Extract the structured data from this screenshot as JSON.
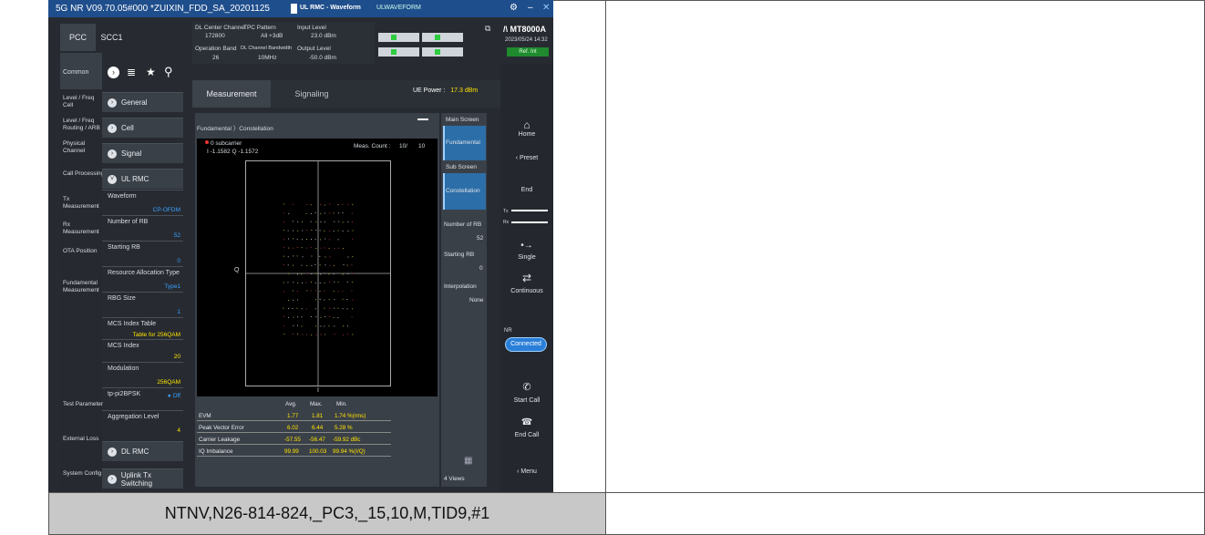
{
  "window": {
    "title": "5G NR V09.70.05#000  *ZUIXIN_FDD_SA_20201125",
    "center_title": "UL RMC - Waveform",
    "center_sub": "ULWAVEFORM"
  },
  "caption": "NTNV,N26-814-824,_PC3,_15,10,M,TID9,#1",
  "carrier_tabs": [
    "PCC",
    "SCC1"
  ],
  "info": {
    "dl_center_channel_label": "DL Center Channel",
    "dl_center_channel_value": "172800",
    "tpc_label": "TPC Pattern",
    "tpc_value": "All +3dB",
    "input_level_label": "Input Level",
    "input_level_value": "23.0 dBm",
    "op_band_label": "Operation Band",
    "op_band_value": "26",
    "dl_bw_label": "DL Channel Bandwidth",
    "dl_bw_value": "10MHz",
    "output_level_label": "Output Level",
    "output_level_value": "-50.0 dBm"
  },
  "brand": {
    "name": "MT8000A",
    "datetime": "2023/05/24 14:32",
    "ref": "Ref. Int"
  },
  "left_nav": [
    "Common",
    "Level / Freq Cell",
    "Level / Freq Routing / ARB",
    "Physical Channel",
    "Call Processing",
    "Tx Measurement",
    "Rx Measurement",
    "OTA Position",
    "Fundamental Measurement",
    "Test Parameter",
    "External Loss",
    "System Config"
  ],
  "groups": {
    "general": "General",
    "cell": "Cell",
    "signal": "Signal",
    "ul_rmc": "UL RMC",
    "dl_rmc": "DL RMC",
    "uplink": "Uplink Tx Switching"
  },
  "params": [
    {
      "label": "Waveform",
      "value": "CP-OFDM",
      "color": "cyan"
    },
    {
      "label": "Number of RB",
      "value": "52",
      "color": "cyan"
    },
    {
      "label": "Starting RB",
      "value": "0",
      "color": "cyan"
    },
    {
      "label": "Resource Allocation Type",
      "value": "Type1",
      "color": "cyan"
    },
    {
      "label": "RBG Size",
      "value": "1",
      "color": "cyan"
    },
    {
      "label": "MCS Index Table",
      "value": "Table for 256QAM",
      "color": "yellow"
    },
    {
      "label": "MCS Index",
      "value": "20",
      "color": "yellow"
    },
    {
      "label": "Modulation",
      "value": "256QAM",
      "color": "yellow"
    },
    {
      "label": "tp-pi2BPSK",
      "value": "Off",
      "color": "cyan"
    },
    {
      "label": "Aggregation Level",
      "value": "4",
      "color": "yellow"
    }
  ],
  "tabs": {
    "measurement": "Measurement",
    "signaling": "Signaling"
  },
  "ue_power": {
    "label": "UE Power :",
    "value": "17.3 dBm"
  },
  "breadcrumb": {
    "a": "Fundamental",
    "b": "Constellation"
  },
  "plot": {
    "marker1": "0 subcarrier",
    "marker2": "I -1.1582 Q -1.1572",
    "meas_label": "Meas. Count :",
    "meas_value": "10/",
    "meas_total": "10",
    "q_label": "Q",
    "i_label": "I"
  },
  "results": {
    "headers": [
      "Avg.",
      "Max.",
      "Min."
    ],
    "rows": [
      {
        "name": "EVM",
        "avg": "1.77",
        "max": "1.81",
        "min": "1.74 %(rms)"
      },
      {
        "name": "Peak Vector Error",
        "avg": "6.02",
        "max": "6.44",
        "min": "5.28 %"
      },
      {
        "name": "Carrier Leakage",
        "avg": "-57.55",
        "max": "-56.47",
        "min": "-59.92 dBc"
      },
      {
        "name": "IQ Imbalance",
        "avg": "99.99",
        "max": "100.03",
        "min": "99.94 %(I/Q)"
      }
    ]
  },
  "screen_panel": {
    "main": "Main Screen",
    "fundamental": "Fundamental",
    "sub": "Sub Screen",
    "constellation": "Constellation",
    "nrb_label": "Number of RB",
    "nrb_value": "52",
    "srb_label": "Starting RB",
    "srb_value": "0",
    "interp_label": "Interpolation",
    "interp_value": "None",
    "views": "4 Views"
  },
  "right": {
    "home": "Home",
    "preset": "Preset",
    "end": "End",
    "tx": "Tx",
    "rx": "Rx",
    "single": "Single",
    "continuous": "Continuous",
    "nr": "NR",
    "connected": "Connected",
    "start_call": "Start Call",
    "end_call": "End Call",
    "menu": "Menu"
  },
  "colors": {
    "accent": "#3aa0ff",
    "value_yellow": "#ffe400",
    "titlebar": "#1f4e8c",
    "connected": "#2a7fd8"
  }
}
